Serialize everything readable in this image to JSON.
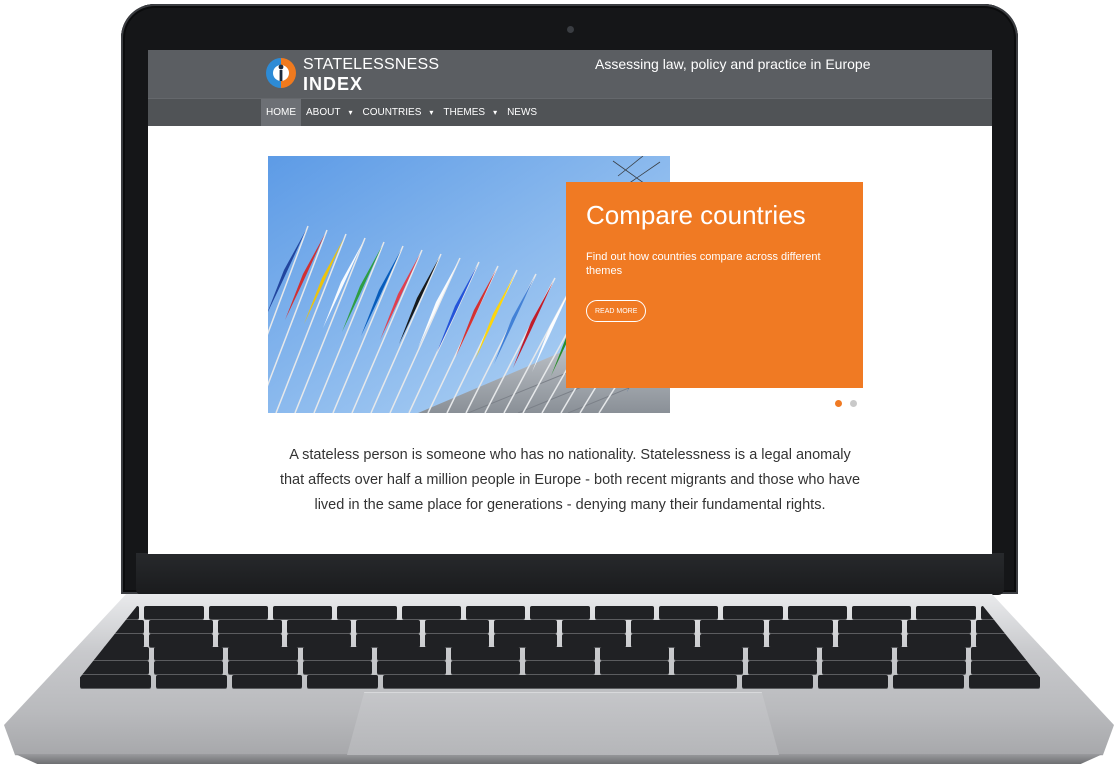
{
  "site": {
    "logo_line1": "STATELESSNESS",
    "logo_line2": "INDEX",
    "tagline": "Assessing law, policy and practice in Europe"
  },
  "nav": {
    "items": [
      "HOME",
      "ABOUT",
      "COUNTRIES",
      "THEMES",
      "NEWS"
    ],
    "active": "HOME",
    "dropdown_marker": "▾"
  },
  "slider": {
    "title": "Compare countries",
    "text": "Find out how countries compare across different themes",
    "button": "READ MORE",
    "slide_count": 2,
    "active_slide": 1
  },
  "intro": "A stateless person is someone who has no nationality. Statelessness is a legal anomaly that affects over half a million people in Europe - both recent migrants and those who have lived in the same place for generations - denying many their fundamental rights.",
  "colors": {
    "header": "#5b5e62",
    "accent_orange": "#f07a23",
    "logo_blue": "#2d8bd6"
  }
}
